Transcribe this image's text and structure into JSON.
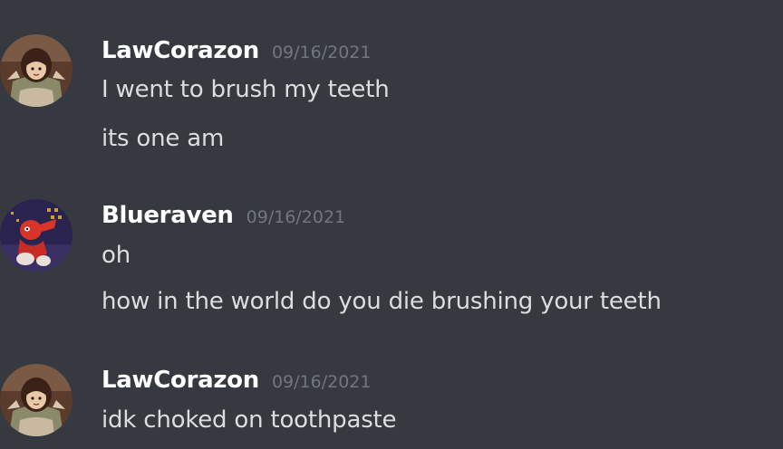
{
  "messages": [
    {
      "author": "LawCorazon",
      "timestamp": "09/16/2021",
      "avatar_icon": "anime-girl-avatar-icon",
      "lines": [
        "I went to brush my teeth",
        "its one am"
      ]
    },
    {
      "author": "Blueraven",
      "timestamp": "09/16/2021",
      "avatar_icon": "red-figure-avatar-icon",
      "lines": [
        "oh",
        "how in the world do you die brushing your teeth"
      ]
    },
    {
      "author": "LawCorazon",
      "timestamp": "09/16/2021",
      "avatar_icon": "anime-girl-avatar-icon",
      "lines": [
        "idk choked on toothpaste"
      ]
    }
  ],
  "colors": {
    "background": "#36393f",
    "username": "#ffffff",
    "timestamp": "#72767d",
    "message_text": "#dcddde"
  }
}
